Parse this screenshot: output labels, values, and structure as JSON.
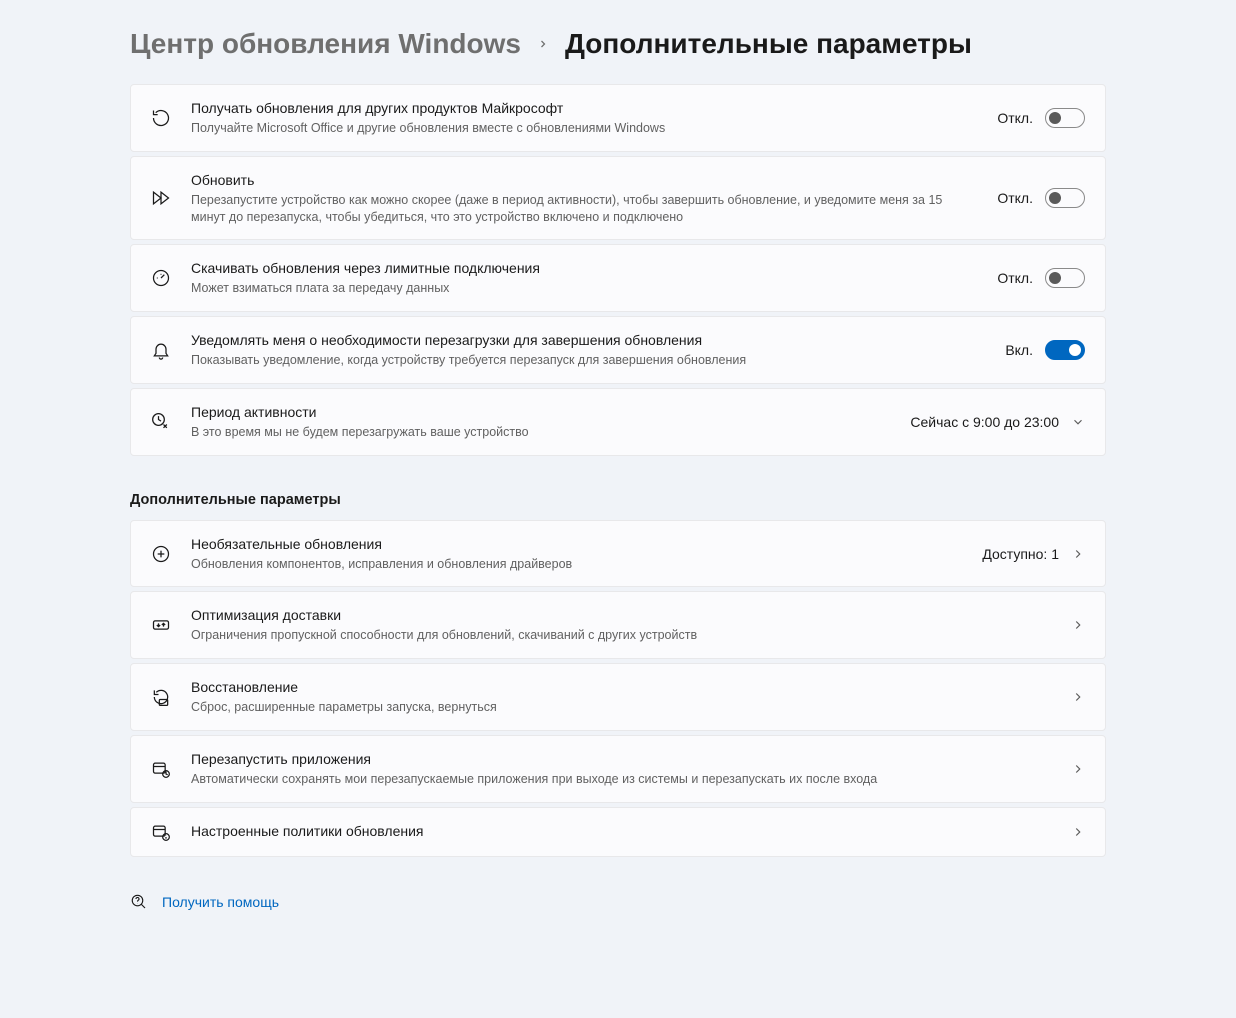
{
  "breadcrumb": {
    "parent": "Центр обновления Windows",
    "current": "Дополнительные параметры"
  },
  "labels": {
    "off": "Откл.",
    "on": "Вкл."
  },
  "cards": {
    "other_products": {
      "title": "Получать обновления для других продуктов Майкрософт",
      "subtitle": "Получайте Microsoft Office и другие обновления вместе с обновлениями Windows",
      "state": "off"
    },
    "update": {
      "title": "Обновить",
      "subtitle": "Перезапустите устройство как можно скорее (даже в период активности), чтобы завершить обновление, и уведомите меня за 15 минут до перезапуска, чтобы убедиться, что это устройство включено и подключено",
      "state": "off"
    },
    "metered": {
      "title": "Скачивать обновления через лимитные подключения",
      "subtitle": "Может взиматься плата за передачу данных",
      "state": "off"
    },
    "notify_restart": {
      "title": "Уведомлять меня о необходимости перезагрузки для завершения обновления",
      "subtitle": "Показывать уведомление, когда устройству требуется перезапуск для завершения обновления",
      "state": "on"
    },
    "active_hours": {
      "title": "Период активности",
      "subtitle": "В это время мы не будем перезагружать ваше устройство",
      "value": "Сейчас с 9:00 до 23:00"
    }
  },
  "section_heading": "Дополнительные параметры",
  "nav": {
    "optional_updates": {
      "title": "Необязательные обновления",
      "subtitle": "Обновления компонентов, исправления и обновления драйверов",
      "value": "Доступно: 1"
    },
    "delivery_optimization": {
      "title": "Оптимизация доставки",
      "subtitle": "Ограничения пропускной способности для обновлений, скачиваний с других устройств"
    },
    "recovery": {
      "title": "Восстановление",
      "subtitle": "Сброс, расширенные параметры запуска, вернуться"
    },
    "restart_apps": {
      "title": "Перезапустить приложения",
      "subtitle": "Автоматически сохранять мои перезапускаемые приложения при выходе из системы и перезапускать их после входа"
    },
    "configured_policies": {
      "title": "Настроенные политики обновления"
    }
  },
  "help": {
    "label": "Получить помощь"
  }
}
